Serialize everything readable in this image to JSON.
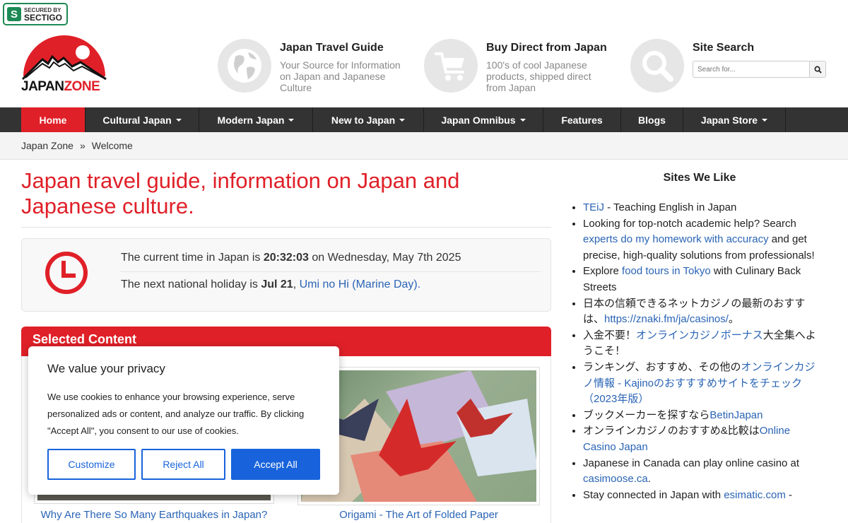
{
  "badge": {
    "small": "SECURED BY",
    "big": "SECTIGO",
    "glyph": "S"
  },
  "logo": {
    "japan": "JAPAN",
    "zone": "ZONE"
  },
  "header": {
    "blocks": [
      {
        "title": "Japan Travel Guide",
        "sub": "Your Source for Information on Japan and Japanese Culture",
        "icon": "globe-icon"
      },
      {
        "title": "Buy Direct from Japan",
        "sub": "100's of cool Japanese products, shipped direct from Japan",
        "icon": "cart-icon"
      },
      {
        "title": "Site Search",
        "icon": "magnifier-icon"
      }
    ],
    "search_placeholder": "Search for..."
  },
  "nav": [
    {
      "label": "Home",
      "active": true
    },
    {
      "label": "Cultural Japan",
      "dropdown": true
    },
    {
      "label": "Modern Japan",
      "dropdown": true
    },
    {
      "label": "New to Japan",
      "dropdown": true
    },
    {
      "label": "Japan Omnibus",
      "dropdown": true
    },
    {
      "label": "Features"
    },
    {
      "label": "Blogs"
    },
    {
      "label": "Japan Store",
      "dropdown": true
    }
  ],
  "breadcrumb": {
    "root": "Japan Zone",
    "sep": "»",
    "current": "Welcome"
  },
  "main": {
    "title": "Japan travel guide, information on Japan and Japanese culture.",
    "time": {
      "pre": "The current time in Japan is ",
      "time": "20:32:03",
      "mid": " on Wednesday, May 7th 2025",
      "holiday_pre": "The next national holiday is ",
      "holiday_date": "Jul 21",
      "holiday_comma": ", ",
      "holiday_name": "Umi no Hi (Marine Day)."
    },
    "selected_title": "Selected Content",
    "captions": [
      "Why Are There So Many Earthquakes in Japan?",
      "Origami - The Art of Folded Paper"
    ]
  },
  "cookie": {
    "title": "We value your privacy",
    "text": "We use cookies to enhance your browsing experience, serve personalized ads or content, and analyze our traffic. By clicking \"Accept All\", you consent to our use of cookies.",
    "customize": "Customize",
    "reject": "Reject All",
    "accept": "Accept All"
  },
  "sidebar": {
    "title": "Sites We Like",
    "items": [
      {
        "link": "TEiJ",
        "after": " - Teaching English in Japan"
      },
      {
        "before": "Looking for top-notch academic help? Search ",
        "link": "experts do my homework with accuracy",
        "after": " and get precise, high-quality solutions from professionals!"
      },
      {
        "before": "Explore ",
        "link": "food tours in Tokyo",
        "after": " with Culinary Back Streets"
      },
      {
        "before": "日本の信頼できるネットカジノの最新のおすすは、",
        "link": "https://znaki.fm/ja/casinos/",
        "after": "。"
      },
      {
        "before": "入金不要！",
        "link": "オンラインカジノボーナス",
        "after": "大全集へようこそ！"
      },
      {
        "before": "ランキング、おすすめ、その他の",
        "link": "オンラインカジノ情報 - Kajinoのおすすすめサイトをチェック（2023年版）",
        "after": ""
      },
      {
        "before": "ブックメーカーを探すなら",
        "link": "BetinJapan",
        "after": ""
      },
      {
        "before": "オンラインカジノのおすすめ&比較は",
        "link": "Online Casino Japan",
        "after": ""
      },
      {
        "before": "Japanese in Canada can play online casino at ",
        "link": "casimoose.ca",
        "after": "."
      },
      {
        "before": "Stay connected in Japan with ",
        "link": "esimatic.com",
        "after": " -"
      }
    ]
  },
  "colors": {
    "brand_red": "#e02028",
    "nav_dark": "#333333",
    "link_blue": "#2a64b5",
    "cookie_blue": "#1863dc"
  }
}
